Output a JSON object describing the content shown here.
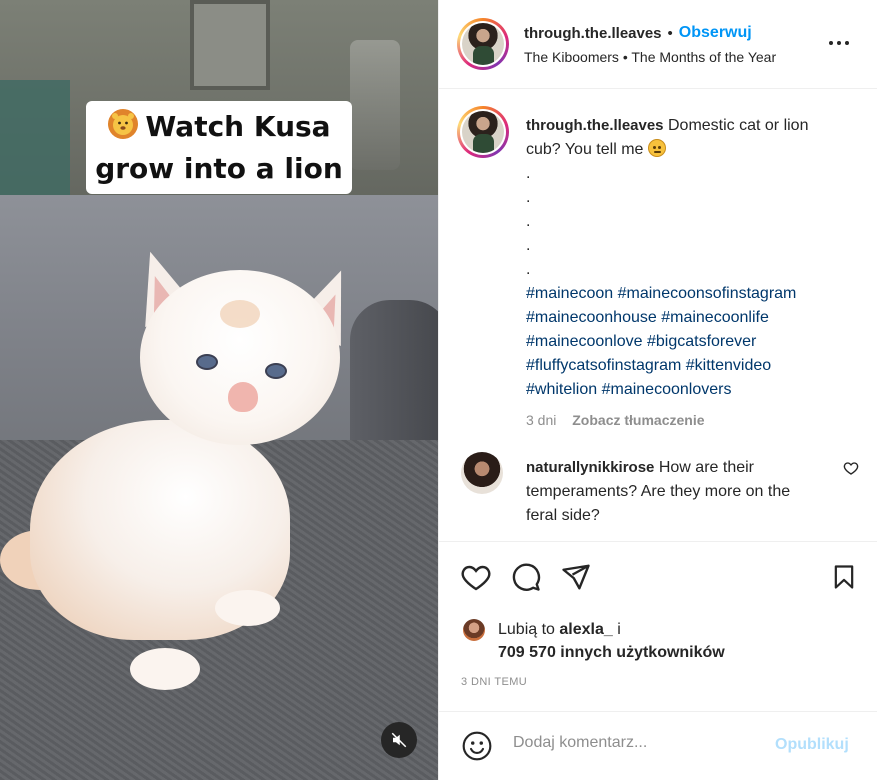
{
  "post": {
    "author": "through.the.lleaves",
    "follow_label": "Obserwuj",
    "audio_line": "The Kiboomers • The Months of the Year",
    "more_icon": "more-horizontal-icon"
  },
  "media": {
    "overlay_line1": "Watch Kusa",
    "overlay_line2": "grow into a lion",
    "overlay_emoji": "lion-face-icon",
    "mute_icon": "speaker-muted-icon"
  },
  "caption": {
    "username": "through.the.lleaves",
    "text": "Domestic cat or lion cub? You tell me",
    "emoji": "worried-face-icon",
    "dot_lines": [
      ".",
      ".",
      ".",
      ".",
      "."
    ],
    "hashtags": "#mainecoon #mainecoonsofinstagram #mainecoonhouse #mainecoonlife #mainecoonlove #bigcatsforever #fluffycatsofinstagram #kittenvideo #whitelion #mainecoonlovers",
    "age": "3 dni",
    "translate_label": "Zobacz tłumaczenie"
  },
  "comment": {
    "username": "naturallynikkirose",
    "text": "How are their temperaments? Are they more on the feral side?"
  },
  "likes": {
    "prefix": "Lubią to",
    "user": "alexla_",
    "conjunction": "i",
    "count_line": "709 570 innych użytkowników"
  },
  "timestamp": "3 DNI TEMU",
  "composer": {
    "placeholder": "Dodaj komentarz...",
    "publish_label": "Opublikuj"
  },
  "colors": {
    "link_blue": "#0095f6",
    "hashtag": "#00376b",
    "muted": "#8e8e8e",
    "publish_disabled": "#b2dffc"
  }
}
